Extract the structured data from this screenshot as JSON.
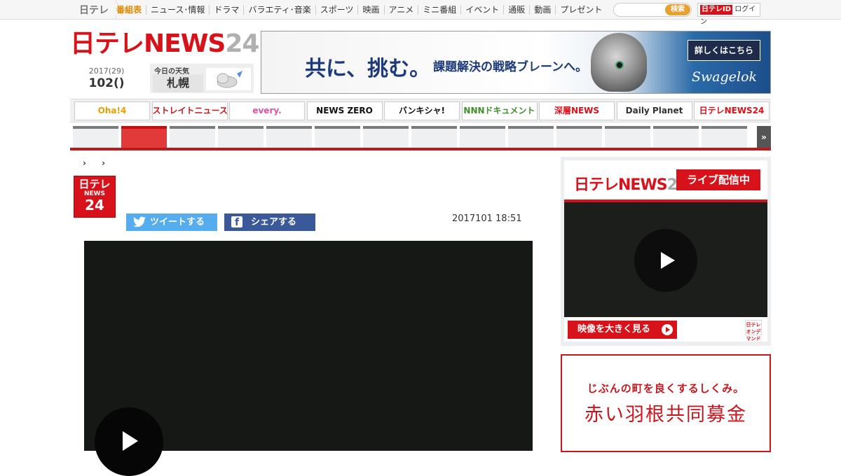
{
  "topnav": {
    "brand": "日テレ",
    "items": [
      {
        "label": "番組表",
        "active": true
      },
      {
        "label": "ニュース･情報"
      },
      {
        "label": "ドラマ"
      },
      {
        "label": "バラエティ･音楽"
      },
      {
        "label": "スポーツ"
      },
      {
        "label": "映画"
      },
      {
        "label": "アニメ"
      },
      {
        "label": "ミニ番組"
      },
      {
        "label": "イベント"
      },
      {
        "label": "通販"
      },
      {
        "label": "動画"
      },
      {
        "label": "プレゼント"
      }
    ],
    "search_placeholder": "",
    "search_button": "検索",
    "login_logo": "日テレID",
    "login_label": "ログイン"
  },
  "header": {
    "logo_main": "日テレNEWS",
    "logo_num": "24",
    "date_line1": "2017(29)",
    "date_line2": "102()",
    "weather_label": "今日の天気",
    "weather_city": "札幌",
    "weather_icon": "cloud-rain-icon"
  },
  "banner": {
    "headline": "共に、挑む。",
    "subline": "課題解決の戦略ブレーンへ。",
    "cta": "詳しくはこちら",
    "brand": "Swagelok"
  },
  "programs": [
    {
      "label": "Oha!4",
      "color": "#e8a000"
    },
    {
      "label": "ストレイトニュース",
      "color": "#c8161d"
    },
    {
      "label": "every.",
      "color": "#e64fa0"
    },
    {
      "label": "NEWS ZERO",
      "color": "#111111"
    },
    {
      "label": "バンキシャ!",
      "color": "#111111"
    },
    {
      "label": "NNNドキュメント",
      "color": "#3f8e2a"
    },
    {
      "label": "深層NEWS",
      "color": "#d7121b"
    },
    {
      "label": "Daily Planet",
      "color": "#333333"
    },
    {
      "label": "日テレNEWS24",
      "color": "#d7121b"
    }
  ],
  "tabs": {
    "count": 14,
    "active_index": 1,
    "more": "»"
  },
  "breadcrumb": [
    "›",
    "›"
  ],
  "article": {
    "logo_line1": "日テレ",
    "logo_line2": "NEWS",
    "logo_line3": "24",
    "tweet": "ツイートする",
    "share": "シェアする",
    "timestamp": "2017101 18:51"
  },
  "live": {
    "logo_main": "日テレNEWS",
    "logo_num": "24",
    "badge": "ライブ配信中",
    "watch": "映像を大きく見る",
    "mini_logo": "日テレ オンデマンド"
  },
  "ad": {
    "line1": "じぶんの町を良くするしくみ。",
    "line2": "赤い羽根共同募金"
  }
}
